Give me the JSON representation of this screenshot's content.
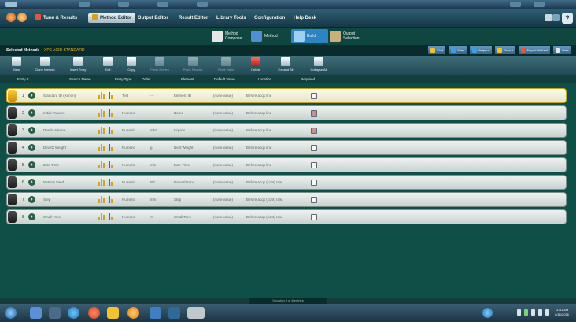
{
  "menubar": {
    "items": [
      "Tune & Results",
      "Method Editor",
      "Output Editor",
      "Result Editor",
      "Library Tools",
      "Configuration",
      "Help Desk"
    ],
    "active_index": 1
  },
  "mode_tabs": [
    {
      "label": "Method Compose",
      "icon_color": "#e6e6e6"
    },
    {
      "label": "Method",
      "icon_color": "#4f8fd6"
    },
    {
      "label": "Build",
      "icon_color": "#3a7fc2"
    },
    {
      "label": "Output Selection",
      "icon_color": "#c9b07a"
    }
  ],
  "selected_mode_index": 2,
  "method_bar": {
    "label": "Selected Method:",
    "name": "XPS ACID STANDARD"
  },
  "right_toolbar": [
    {
      "label": "Find",
      "icon_color": "#f2c230"
    },
    {
      "label": "Scan",
      "icon_color": "#3aa0e6"
    },
    {
      "label": "Acquire",
      "icon_color": "#3aa0e6"
    },
    {
      "label": "Report",
      "icon_color": "#f2c230"
    },
    {
      "label": "Export Method",
      "icon_color": "#e0553c"
    },
    {
      "label": "Save",
      "icon_color": "#dfe8ee"
    }
  ],
  "actions": [
    {
      "label": "New",
      "disabled": false,
      "red": false
    },
    {
      "label": "Clone Method",
      "disabled": false,
      "red": false
    },
    {
      "label": "Insert Entry",
      "disabled": false,
      "red": false
    },
    {
      "label": "Edit",
      "disabled": false,
      "red": false
    },
    {
      "label": "Copy",
      "disabled": false,
      "red": false
    },
    {
      "label": "Paste Entries",
      "disabled": true,
      "red": false
    },
    {
      "label": "Paste Results",
      "disabled": true,
      "red": false
    },
    {
      "label": "Paste Table",
      "disabled": true,
      "red": false
    },
    {
      "label": "Delete",
      "disabled": false,
      "red": true
    },
    {
      "label": "Expand All",
      "disabled": false,
      "red": false
    },
    {
      "label": "Collapse All",
      "disabled": false,
      "red": false
    }
  ],
  "columns": [
    "Entry #",
    "Search Name",
    "Entry Type",
    "Order",
    "Element",
    "Default Value",
    "Location",
    "Required"
  ],
  "rows": [
    {
      "num": "1",
      "name": "Standard ID (Xenon)",
      "type": "Text",
      "order": "---",
      "element": "Element ID",
      "default": "(none value)",
      "location": "Before acqs line",
      "required": false,
      "selected": true
    },
    {
      "num": "2",
      "name": "Initial Volume",
      "type": "Numeric",
      "order": "---",
      "element": "Name",
      "default": "(none value)",
      "location": "Before acqs line",
      "required": true,
      "selected": false
    },
    {
      "num": "3",
      "name": "Death Volume",
      "type": "Numeric",
      "order": "mkd",
      "element": "Liquids",
      "default": "(none value)",
      "location": "Before acqs line",
      "required": true,
      "selected": false
    },
    {
      "num": "4",
      "name": "Dev ID Weight",
      "type": "Numeric",
      "order": "g",
      "element": "Next Weight",
      "default": "(none value)",
      "location": "Before acqs line",
      "required": false,
      "selected": false
    },
    {
      "num": "5",
      "name": "Extr. Time",
      "type": "Numeric",
      "order": "min",
      "element": "Extr. Time",
      "default": "(none value)",
      "location": "Before acqs line",
      "required": false,
      "selected": false
    },
    {
      "num": "6",
      "name": "Natural Sand",
      "type": "Numeric",
      "order": "Bd",
      "element": "Natural Sand",
      "default": "(none value)",
      "location": "Before acqs (cont) raw",
      "required": false,
      "selected": false
    },
    {
      "num": "7",
      "name": "Step",
      "type": "Numeric",
      "order": "mm",
      "element": "Step",
      "default": "(none value)",
      "location": "Before acqs (cont) raw",
      "required": false,
      "selected": false
    },
    {
      "num": "8",
      "name": "Small Tone",
      "type": "Numeric",
      "order": "%",
      "element": "Small Tone",
      "default": "(none value)",
      "location": "Before acqs (cont) raw",
      "required": false,
      "selected": false
    }
  ],
  "status": {
    "text": "Showing 8 of 8 entries"
  },
  "taskbar": {
    "app_icons": [
      "start-orb-icon",
      "file-manager-icon",
      "media-icon",
      "browser-icon",
      "app-red-icon",
      "notes-icon",
      "app-orange-icon",
      "window-icon",
      "network-icon",
      "instrument-icon"
    ],
    "clock_time": "11:41 AM",
    "clock_date": "8/16/2016"
  },
  "colors": {
    "background": "#0e4f47",
    "accent_yellow": "#e6b422",
    "selected_tab": "#2c85c2"
  }
}
